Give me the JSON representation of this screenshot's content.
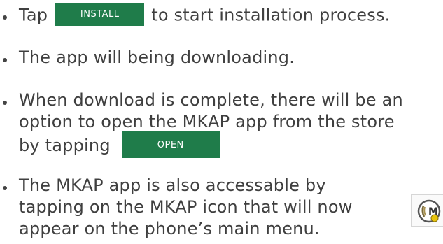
{
  "instructions": [
    {
      "lines": [
        "Tap",
        "to start installation process."
      ],
      "button_label": "INSTALL"
    },
    {
      "lines": [
        "The app will being downloading."
      ]
    },
    {
      "lines": [
        "When download is complete, there will be an",
        "option to open the MKAP app from the store",
        "by tapping"
      ],
      "button_label": "OPEN"
    },
    {
      "lines": [
        "The MKAP app is also accessable by",
        "tapping on the MKAP icon that will now",
        "appear on the phone’s main menu."
      ],
      "icon_name": "mkap-app-icon"
    }
  ],
  "colors": {
    "button_bg": "#1f7c4a",
    "button_text": "#ffffff",
    "body_text": "#3f3f3f"
  }
}
